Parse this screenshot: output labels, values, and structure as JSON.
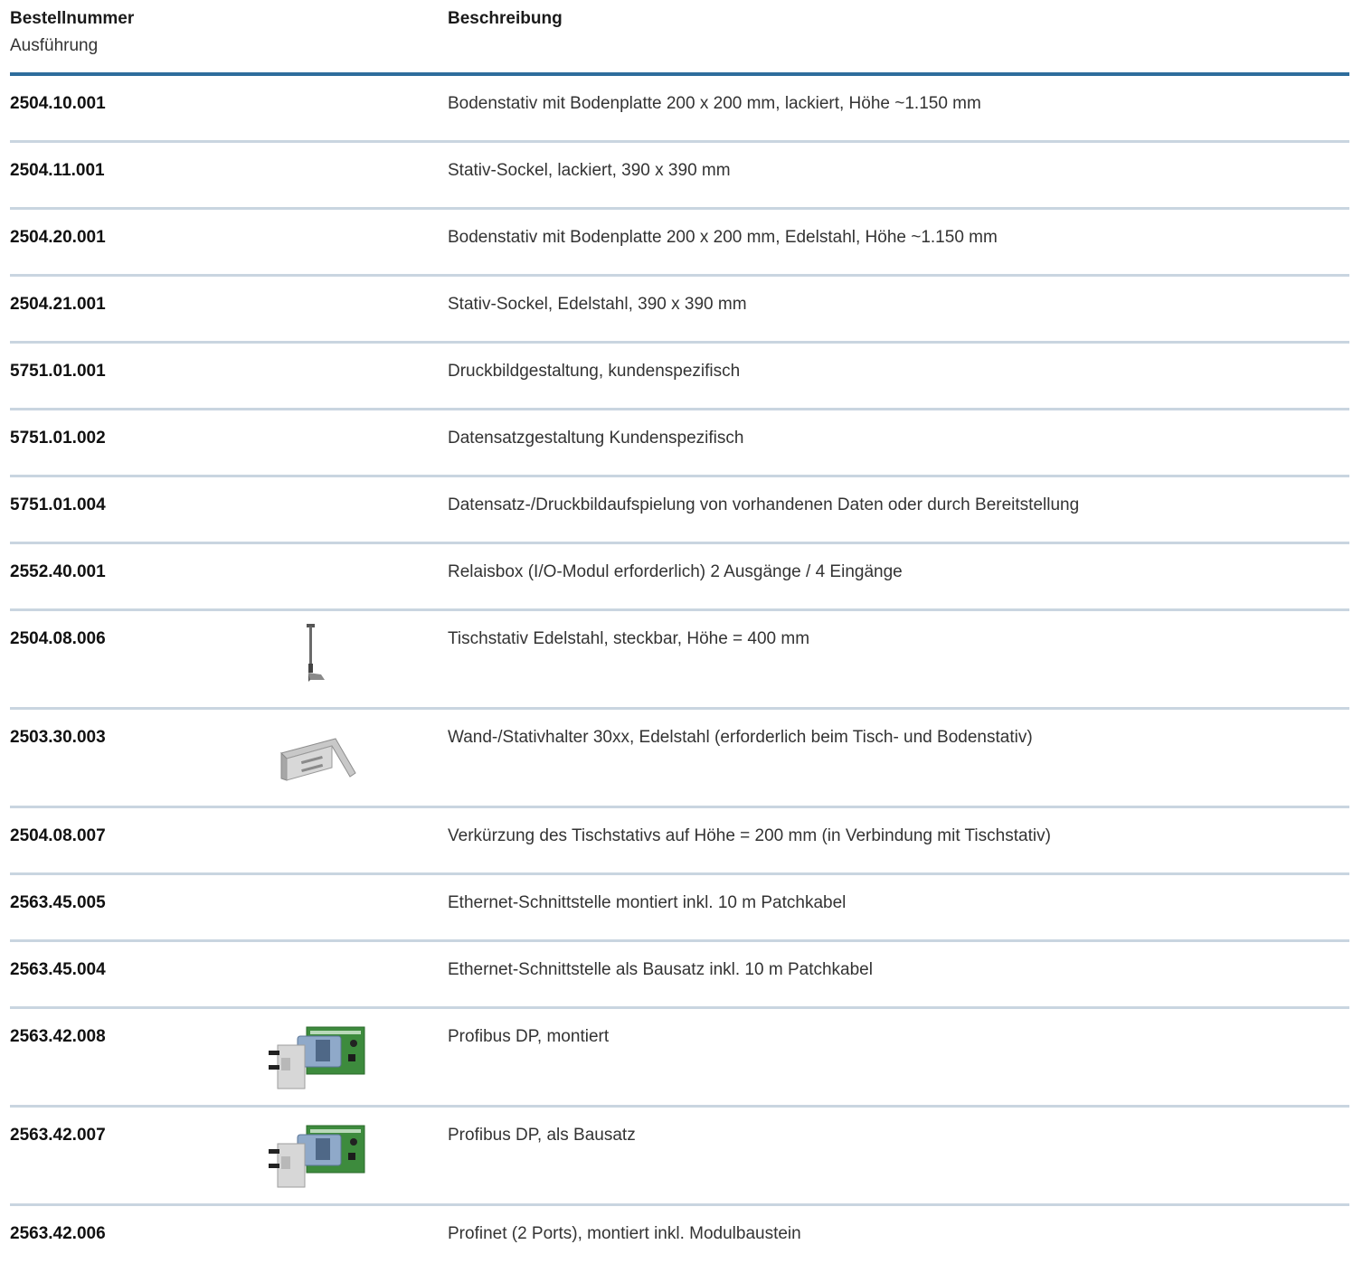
{
  "header": {
    "col1_title": "Bestellnummer",
    "col1_subtitle": "Ausführung",
    "col2_title": "Beschreibung"
  },
  "rows": [
    {
      "number": "2504.10.001",
      "description": "Bodenstativ mit Bodenplatte 200 x 200 mm, lackiert, Höhe ~1.150 mm"
    },
    {
      "number": "2504.11.001",
      "description": "Stativ-Sockel, lackiert, 390 x 390 mm"
    },
    {
      "number": "2504.20.001",
      "description": "Bodenstativ mit Bodenplatte 200 x 200 mm, Edelstahl, Höhe ~1.150 mm"
    },
    {
      "number": "2504.21.001",
      "description": "Stativ-Sockel, Edelstahl, 390 x 390 mm"
    },
    {
      "number": "5751.01.001",
      "description": "Druckbildgestaltung, kundenspezifisch"
    },
    {
      "number": "5751.01.002",
      "description": "Datensatzgestaltung Kundenspezifisch"
    },
    {
      "number": "5751.01.004",
      "description": "Datensatz-/Druckbildaufspielung von vorhandenen Daten oder durch Bereitstellung"
    },
    {
      "number": "2552.40.001",
      "description": "Relaisbox (I/O-Modul erforderlich) 2 Ausgänge / 4 Eingänge"
    },
    {
      "number": "2504.08.006",
      "description": "Tischstativ Edelstahl, steckbar, Höhe = 400 mm",
      "image": "table-stand-icon"
    },
    {
      "number": "2503.30.003",
      "description": "Wand-/Stativhalter 30xx, Edelstahl (erforderlich beim Tisch- und Bodenstativ)",
      "image": "wall-bracket-icon"
    },
    {
      "number": "2504.08.007",
      "description": "Verkürzung des Tischstativs auf Höhe = 200 mm (in Verbindung mit Tischstativ)"
    },
    {
      "number": "2563.45.005",
      "description": "Ethernet-Schnittstelle montiert inkl. 10 m Patchkabel"
    },
    {
      "number": "2563.45.004",
      "description": "Ethernet-Schnittstelle als Bausatz inkl. 10 m Patchkabel"
    },
    {
      "number": "2563.42.008",
      "description": "Profibus DP, montiert",
      "image": "profibus-module-icon"
    },
    {
      "number": "2563.42.007",
      "description": "Profibus DP, als Bausatz",
      "image": "profibus-module-icon"
    },
    {
      "number": "2563.42.006",
      "description": "Profinet (2 Ports), montiert inkl. Modulbaustein"
    }
  ],
  "colors": {
    "header_rule": "#2e6d9c",
    "row_divider": "#c9d5e0"
  }
}
